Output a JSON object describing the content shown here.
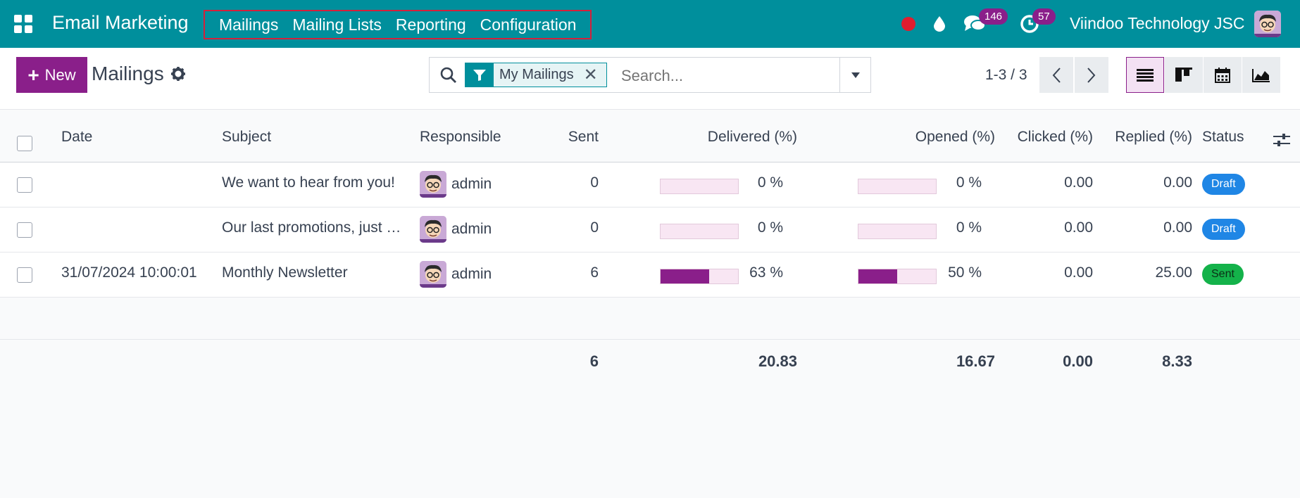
{
  "navbar": {
    "app_name": "Email Marketing",
    "menu": [
      "Mailings",
      "Mailing Lists",
      "Reporting",
      "Configuration"
    ],
    "messages_count": "146",
    "activities_count": "57",
    "company": "Viindoo Technology JSC"
  },
  "control": {
    "new_label": "New",
    "title": "Mailings",
    "facet_label": "My Mailings",
    "search_placeholder": "Search...",
    "pager": "1-3 / 3"
  },
  "table": {
    "columns": [
      "Date",
      "Subject",
      "Responsible",
      "Sent",
      "Delivered (%)",
      "Opened (%)",
      "Clicked (%)",
      "Replied (%)",
      "Status"
    ],
    "rows": [
      {
        "date": "",
        "subject": "We want to hear from you!",
        "responsible": "admin",
        "sent": "0",
        "delivered": 0,
        "delivered_label": "0 %",
        "opened": 0,
        "opened_label": "0 %",
        "clicked": "0.00",
        "replied": "0.00",
        "status": "Draft"
      },
      {
        "date": "",
        "subject": "Our last promotions, just …",
        "responsible": "admin",
        "sent": "0",
        "delivered": 0,
        "delivered_label": "0 %",
        "opened": 0,
        "opened_label": "0 %",
        "clicked": "0.00",
        "replied": "0.00",
        "status": "Draft"
      },
      {
        "date": "31/07/2024 10:00:01",
        "subject": "Monthly Newsletter",
        "responsible": "admin",
        "sent": "6",
        "delivered": 63,
        "delivered_label": "63 %",
        "opened": 50,
        "opened_label": "50 %",
        "clicked": "0.00",
        "replied": "25.00",
        "status": "Sent"
      }
    ],
    "totals": {
      "sent": "6",
      "delivered": "20.83",
      "opened": "16.67",
      "clicked": "0.00",
      "replied": "8.33"
    }
  },
  "colors": {
    "navbar": "#008f9c",
    "primary": "#8a1f8a",
    "draft": "#1f86e5",
    "sent": "#14b24a"
  }
}
